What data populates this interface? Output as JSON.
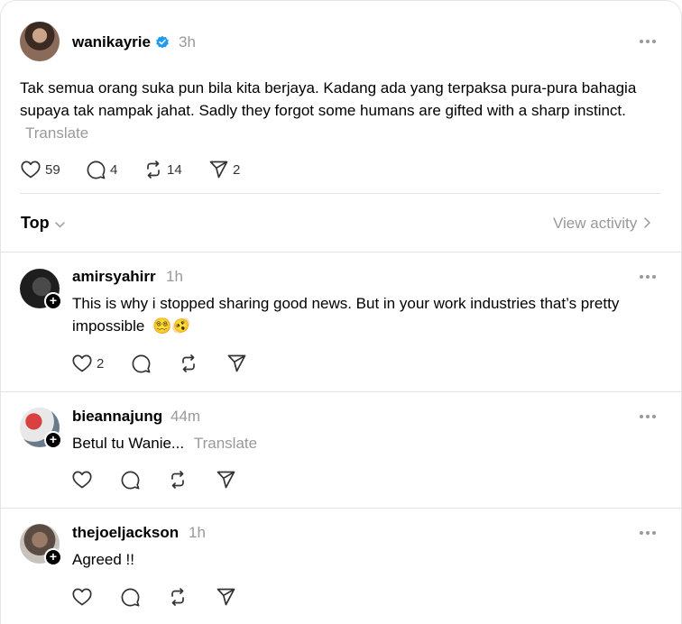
{
  "post": {
    "username": "wanikayrie",
    "time": "3h",
    "text": "Tak semua orang suka pun bila kita berjaya. Kadang ada yang terpaksa pura-pura bahagia supaya tak nampak jahat. Sadly they forgot some humans are gifted with a sharp instinct.",
    "translate_label": "Translate",
    "likes": "59",
    "replies": "4",
    "reposts": "14",
    "shares": "2"
  },
  "sort": {
    "label": "Top",
    "view_activity": "View activity"
  },
  "replies": [
    {
      "username": "amirsyahirr",
      "time": "1h",
      "text": "This is why i stopped sharing good news. But in your work industries that’s pretty impossible",
      "emojis": "😵‍💫🫨",
      "likes": "2"
    },
    {
      "username": "bieannajung",
      "time": "44m",
      "text": "Betul tu Wanie...",
      "translate_label": "Translate"
    },
    {
      "username": "thejoeljackson",
      "time": "1h",
      "text": "Agreed !!"
    }
  ],
  "icons": {
    "verified": "verified-badge-icon",
    "like": "heart-icon",
    "reply": "comment-icon",
    "repost": "repost-icon",
    "share": "send-icon",
    "more": "more-horizontal-icon"
  },
  "colors": {
    "verified": "#1d9bf0",
    "muted": "#999999"
  }
}
